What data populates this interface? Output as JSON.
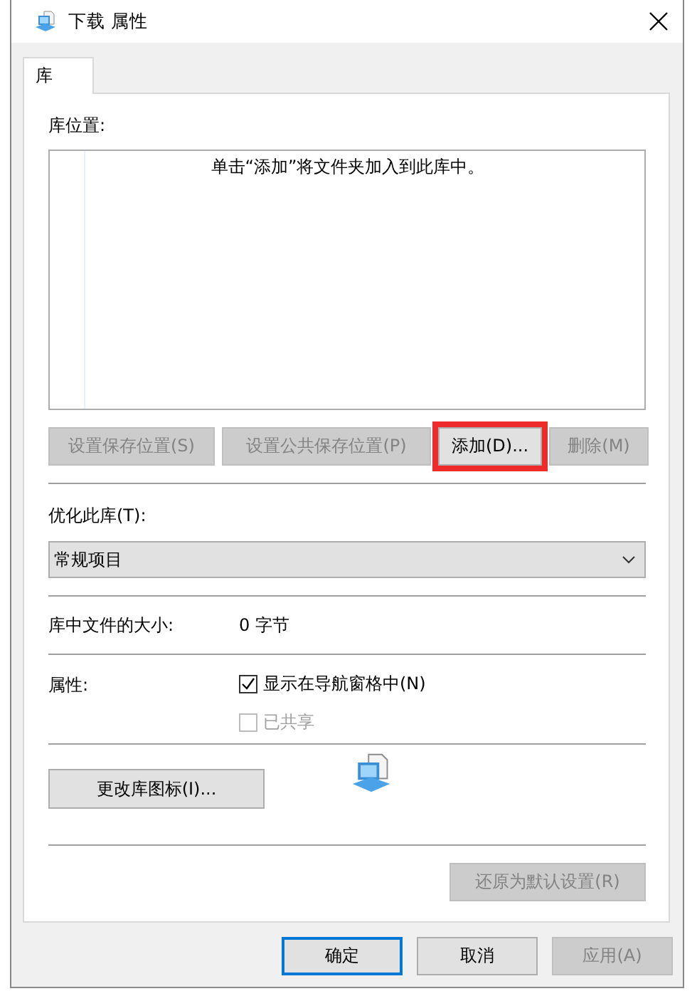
{
  "window": {
    "title": "下载 属性"
  },
  "tabs": [
    {
      "label": "库",
      "selected": true
    }
  ],
  "library_locations": {
    "label": "库位置:",
    "hint": "单击“添加”将文件夹加入到此库中。"
  },
  "location_buttons": [
    {
      "label": "设置保存位置(S)",
      "disabled": true,
      "highlighted": false
    },
    {
      "label": "设置公共保存位置(P)",
      "disabled": true,
      "highlighted": false
    },
    {
      "label": "添加(D)...",
      "disabled": false,
      "highlighted": true
    },
    {
      "label": "删除(M)",
      "disabled": true,
      "highlighted": false
    }
  ],
  "optimize": {
    "label": "优化此库(T):",
    "value": "常规项目"
  },
  "size": {
    "label": "库中文件的大小:",
    "value": "0 字节"
  },
  "attributes": {
    "label": "属性:",
    "options": [
      {
        "label": "显示在导航窗格中(N)",
        "checked": true,
        "disabled": false
      },
      {
        "label": "已共享",
        "checked": false,
        "disabled": true
      }
    ]
  },
  "change_icon_button": "更改库图标(I)...",
  "restore_button": {
    "label": "还原为默认设置(R)",
    "disabled": true
  },
  "buttons": [
    {
      "label": "确定",
      "default": true,
      "disabled": false
    },
    {
      "label": "取消",
      "default": false,
      "disabled": false
    },
    {
      "label": "应用(A)",
      "default": false,
      "disabled": true
    }
  ]
}
